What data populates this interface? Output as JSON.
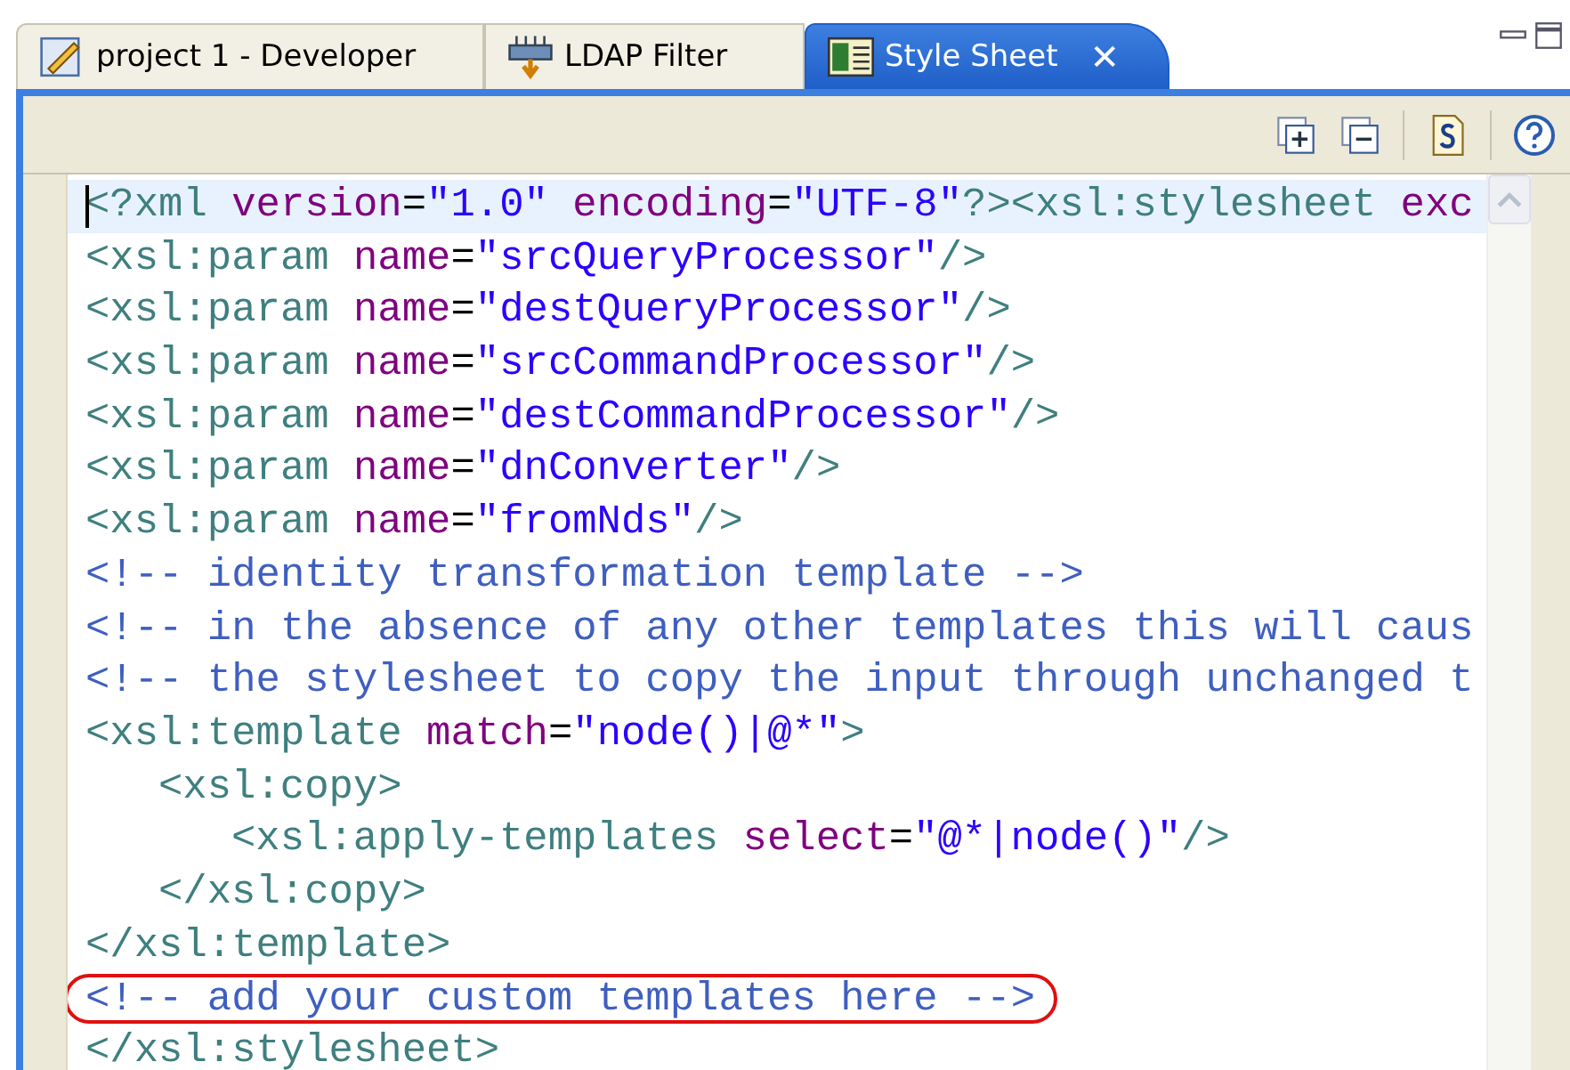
{
  "tabs": [
    {
      "label": "project 1 - Developer",
      "kind": "project",
      "selected": false
    },
    {
      "label": "LDAP Filter",
      "kind": "filter",
      "selected": false
    },
    {
      "label": "Style Sheet",
      "kind": "stylesheet",
      "selected": true,
      "close": "✕"
    }
  ],
  "editor": {
    "lines": [
      {
        "current": true,
        "circled": false,
        "tokens": [
          {
            "kind": "tag",
            "text": "<?xml"
          },
          {
            "kind": "attr",
            "text": " version"
          },
          {
            "kind": "eq",
            "text": "="
          },
          {
            "kind": "val",
            "text": "\"1.0\""
          },
          {
            "kind": "attr",
            "text": " encoding"
          },
          {
            "kind": "eq",
            "text": "="
          },
          {
            "kind": "val",
            "text": "\"UTF-8\""
          },
          {
            "kind": "tag",
            "text": "?>"
          },
          {
            "kind": "tag",
            "text": "<xsl:stylesheet"
          },
          {
            "kind": "attr",
            "text": " exc"
          }
        ]
      },
      {
        "current": false,
        "circled": false,
        "tokens": [
          {
            "kind": "tag",
            "text": "<xsl:param"
          },
          {
            "kind": "attr",
            "text": " name"
          },
          {
            "kind": "eq",
            "text": "="
          },
          {
            "kind": "val",
            "text": "\"srcQueryProcessor\""
          },
          {
            "kind": "tag",
            "text": "/>"
          }
        ]
      },
      {
        "current": false,
        "circled": false,
        "tokens": [
          {
            "kind": "tag",
            "text": "<xsl:param"
          },
          {
            "kind": "attr",
            "text": " name"
          },
          {
            "kind": "eq",
            "text": "="
          },
          {
            "kind": "val",
            "text": "\"destQueryProcessor\""
          },
          {
            "kind": "tag",
            "text": "/>"
          }
        ]
      },
      {
        "current": false,
        "circled": false,
        "tokens": [
          {
            "kind": "tag",
            "text": "<xsl:param"
          },
          {
            "kind": "attr",
            "text": " name"
          },
          {
            "kind": "eq",
            "text": "="
          },
          {
            "kind": "val",
            "text": "\"srcCommandProcessor\""
          },
          {
            "kind": "tag",
            "text": "/>"
          }
        ]
      },
      {
        "current": false,
        "circled": false,
        "tokens": [
          {
            "kind": "tag",
            "text": "<xsl:param"
          },
          {
            "kind": "attr",
            "text": " name"
          },
          {
            "kind": "eq",
            "text": "="
          },
          {
            "kind": "val",
            "text": "\"destCommandProcessor\""
          },
          {
            "kind": "tag",
            "text": "/>"
          }
        ]
      },
      {
        "current": false,
        "circled": false,
        "tokens": [
          {
            "kind": "tag",
            "text": "<xsl:param"
          },
          {
            "kind": "attr",
            "text": " name"
          },
          {
            "kind": "eq",
            "text": "="
          },
          {
            "kind": "val",
            "text": "\"dnConverter\""
          },
          {
            "kind": "tag",
            "text": "/>"
          }
        ]
      },
      {
        "current": false,
        "circled": false,
        "tokens": [
          {
            "kind": "tag",
            "text": "<xsl:param"
          },
          {
            "kind": "attr",
            "text": " name"
          },
          {
            "kind": "eq",
            "text": "="
          },
          {
            "kind": "val",
            "text": "\"fromNds\""
          },
          {
            "kind": "tag",
            "text": "/>"
          }
        ]
      },
      {
        "current": false,
        "circled": false,
        "tokens": [
          {
            "kind": "comment",
            "text": "<!-- identity transformation template -->"
          }
        ]
      },
      {
        "current": false,
        "circled": false,
        "tokens": [
          {
            "kind": "comment",
            "text": "<!-- in the absence of any other templates this will caus"
          }
        ]
      },
      {
        "current": false,
        "circled": false,
        "tokens": [
          {
            "kind": "comment",
            "text": "<!-- the stylesheet to copy the input through unchanged t"
          }
        ]
      },
      {
        "current": false,
        "circled": false,
        "tokens": [
          {
            "kind": "tag",
            "text": "<xsl:template"
          },
          {
            "kind": "attr",
            "text": " match"
          },
          {
            "kind": "eq",
            "text": "="
          },
          {
            "kind": "val",
            "text": "\"node()|@*\""
          },
          {
            "kind": "tag",
            "text": ">"
          }
        ],
        "children": [
          {
            "current": false,
            "circled": false,
            "tokens": [
              {
                "kind": "tag",
                "text": "<xsl:copy>"
              }
            ],
            "children": [
              {
                "current": false,
                "circled": false,
                "tokens": [
                  {
                    "kind": "tag",
                    "text": "<xsl:apply-templates"
                  },
                  {
                    "kind": "attr",
                    "text": " select"
                  },
                  {
                    "kind": "eq",
                    "text": "="
                  },
                  {
                    "kind": "val",
                    "text": "\"@*|node()\""
                  },
                  {
                    "kind": "tag",
                    "text": "/>"
                  }
                ]
              }
            ]
          },
          {
            "current": false,
            "circled": false,
            "tokens": [
              {
                "kind": "tag",
                "text": "</xsl:copy>"
              }
            ]
          }
        ]
      },
      {
        "current": false,
        "circled": false,
        "tokens": [
          {
            "kind": "tag",
            "text": "</xsl:template>"
          }
        ]
      },
      {
        "current": false,
        "circled": true,
        "tokens": [
          {
            "kind": "comment",
            "text": "<!-- add your custom templates here -->"
          }
        ]
      },
      {
        "current": false,
        "circled": false,
        "tokens": [
          {
            "kind": "tag",
            "text": "</xsl:stylesheet>"
          }
        ]
      }
    ]
  }
}
